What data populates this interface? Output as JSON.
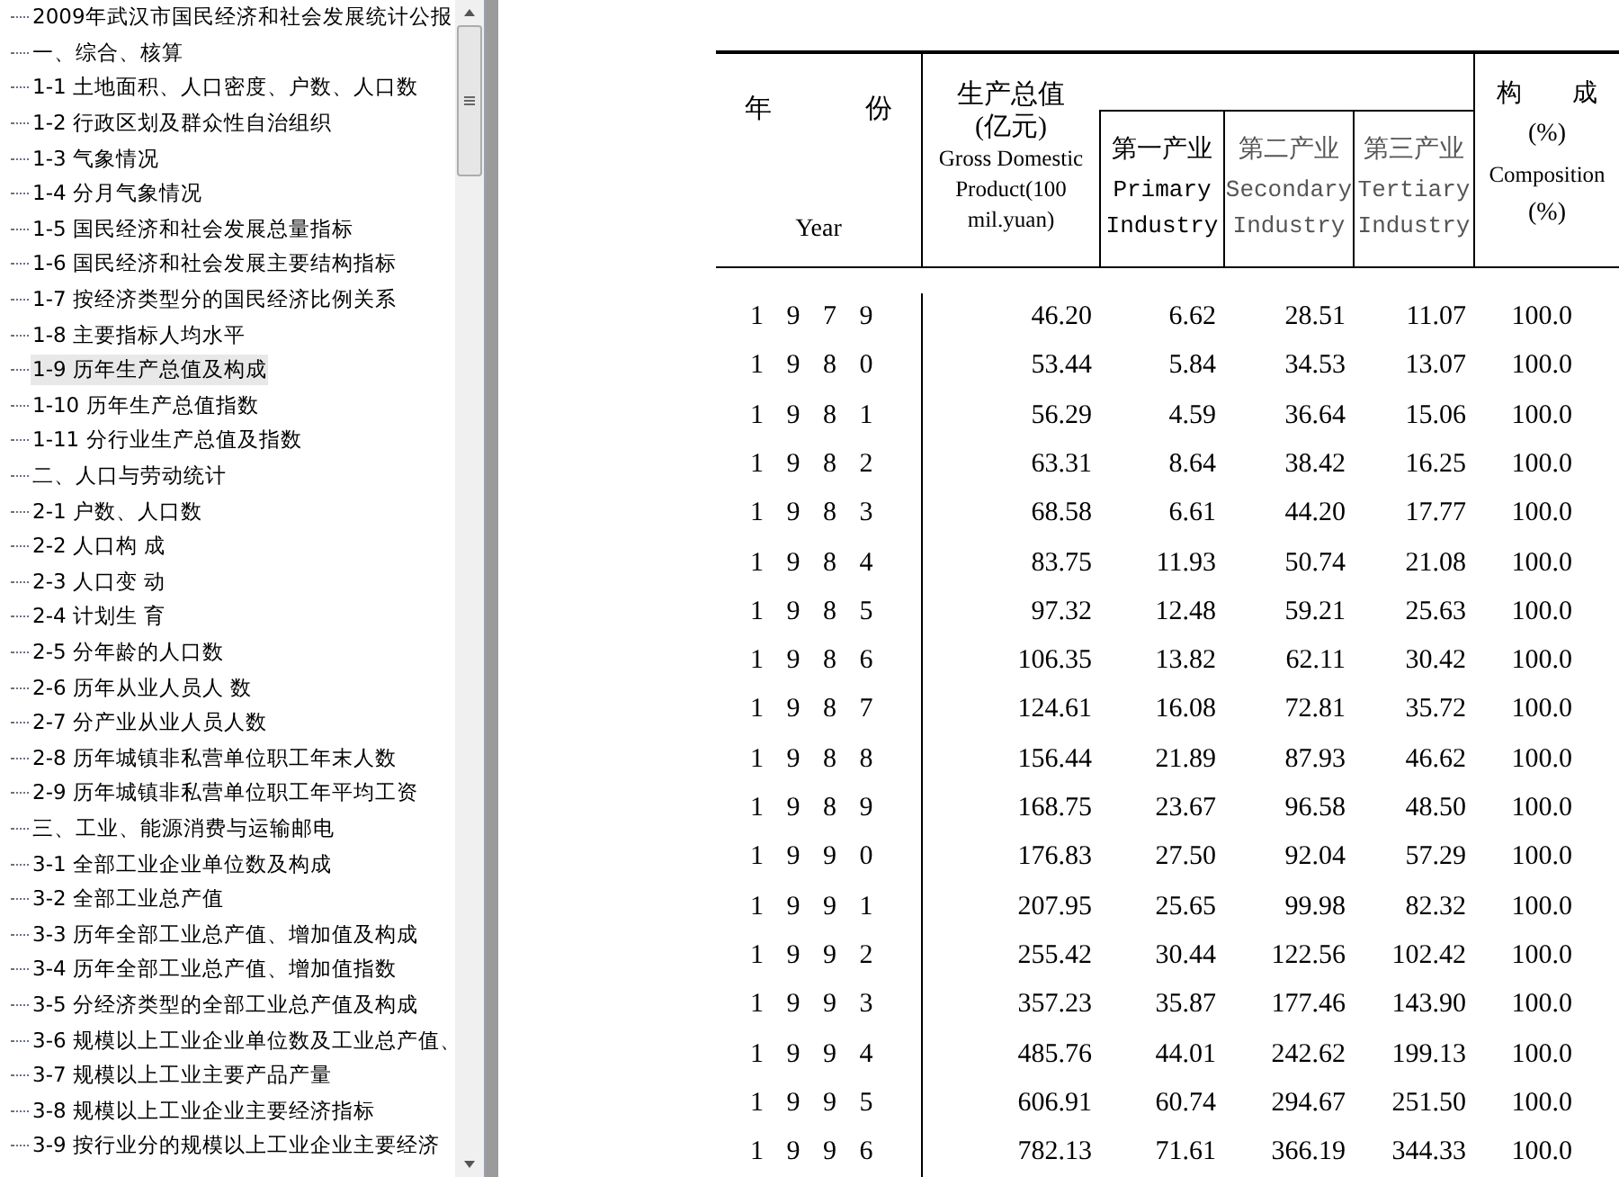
{
  "tree": {
    "items": [
      {
        "label": "2009年武汉市国民经济和社会发展统计公报",
        "selected": false
      },
      {
        "label": "一、综合、核算",
        "selected": false
      },
      {
        "label": "1-1 土地面积、人口密度、户数、人口数",
        "selected": false
      },
      {
        "label": "1-2 行政区划及群众性自治组织",
        "selected": false
      },
      {
        "label": "1-3 气象情况",
        "selected": false
      },
      {
        "label": "1-4 分月气象情况",
        "selected": false
      },
      {
        "label": "1-5 国民经济和社会发展总量指标",
        "selected": false
      },
      {
        "label": "1-6 国民经济和社会发展主要结构指标",
        "selected": false
      },
      {
        "label": "1-7 按经济类型分的国民经济比例关系",
        "selected": false
      },
      {
        "label": "1-8 主要指标人均水平",
        "selected": false
      },
      {
        "label": "1-9 历年生产总值及构成",
        "selected": true
      },
      {
        "label": "1-10 历年生产总值指数",
        "selected": false
      },
      {
        "label": "1-11 分行业生产总值及指数",
        "selected": false
      },
      {
        "label": "二、人口与劳动统计",
        "selected": false
      },
      {
        "label": "2-1 户数、人口数",
        "selected": false
      },
      {
        "label": "2-2 人口构 成",
        "selected": false
      },
      {
        "label": "2-3 人口变 动",
        "selected": false
      },
      {
        "label": "2-4 计划生 育",
        "selected": false
      },
      {
        "label": "2-5 分年龄的人口数",
        "selected": false
      },
      {
        "label": "2-6 历年从业人员人 数",
        "selected": false
      },
      {
        "label": "2-7 分产业从业人员人数",
        "selected": false
      },
      {
        "label": "2-8 历年城镇非私营单位职工年末人数",
        "selected": false
      },
      {
        "label": "2-9 历年城镇非私营单位职工年平均工资",
        "selected": false
      },
      {
        "label": "三、工业、能源消费与运输邮电",
        "selected": false
      },
      {
        "label": "3-1 全部工业企业单位数及构成",
        "selected": false
      },
      {
        "label": "3-2 全部工业总产值",
        "selected": false
      },
      {
        "label": "3-3 历年全部工业总产值、增加值及构成",
        "selected": false
      },
      {
        "label": "3-4 历年全部工业总产值、增加值指数",
        "selected": false
      },
      {
        "label": "3-5 分经济类型的全部工业总产值及构成",
        "selected": false
      },
      {
        "label": "3-6 规模以上工业企业单位数及工业总产值、",
        "selected": false
      },
      {
        "label": "3-7 规模以上工业主要产品产量",
        "selected": false
      },
      {
        "label": "3-8 规模以上工业企业主要经济指标",
        "selected": false
      },
      {
        "label": "3-9 按行业分的规模以上工业企业主要经济",
        "selected": false
      }
    ]
  },
  "table": {
    "header": {
      "year_cn": [
        "年",
        "份"
      ],
      "year_en": "Year",
      "gdp_cn": "生产总值",
      "gdp_unit": "(亿元)",
      "gdp_en": "Gross Domestic Product(100 mil.yuan)",
      "sectors": [
        {
          "cn": "第一产业",
          "en": "Primary Industry"
        },
        {
          "cn": "第二产业",
          "en": "Secondary Industry"
        },
        {
          "cn": "第三产业",
          "en": "Tertiary Industry"
        }
      ],
      "comp_cn": [
        "构",
        "成"
      ],
      "comp_pct": "(%)",
      "comp_en": "Composition",
      "comp_pct2": "(%)"
    },
    "rows": [
      [
        "1979",
        "46.20",
        "6.62",
        "28.51",
        "11.07",
        "100.0"
      ],
      [
        "1980",
        "53.44",
        "5.84",
        "34.53",
        "13.07",
        "100.0"
      ],
      [
        "1981",
        "56.29",
        "4.59",
        "36.64",
        "15.06",
        "100.0"
      ],
      [
        "1982",
        "63.31",
        "8.64",
        "38.42",
        "16.25",
        "100.0"
      ],
      [
        "1983",
        "68.58",
        "6.61",
        "44.20",
        "17.77",
        "100.0"
      ],
      [
        "1984",
        "83.75",
        "11.93",
        "50.74",
        "21.08",
        "100.0"
      ],
      [
        "1985",
        "97.32",
        "12.48",
        "59.21",
        "25.63",
        "100.0"
      ],
      [
        "1986",
        "106.35",
        "13.82",
        "62.11",
        "30.42",
        "100.0"
      ],
      [
        "1987",
        "124.61",
        "16.08",
        "72.81",
        "35.72",
        "100.0"
      ],
      [
        "1988",
        "156.44",
        "21.89",
        "87.93",
        "46.62",
        "100.0"
      ],
      [
        "1989",
        "168.75",
        "23.67",
        "96.58",
        "48.50",
        "100.0"
      ],
      [
        "1990",
        "176.83",
        "27.50",
        "92.04",
        "57.29",
        "100.0"
      ],
      [
        "1991",
        "207.95",
        "25.65",
        "99.98",
        "82.32",
        "100.0"
      ],
      [
        "1992",
        "255.42",
        "30.44",
        "122.56",
        "102.42",
        "100.0"
      ],
      [
        "1993",
        "357.23",
        "35.87",
        "177.46",
        "143.90",
        "100.0"
      ],
      [
        "1994",
        "485.76",
        "44.01",
        "242.62",
        "199.13",
        "100.0"
      ],
      [
        "1995",
        "606.91",
        "60.74",
        "294.67",
        "251.50",
        "100.0"
      ],
      [
        "1996",
        "782.13",
        "71.61",
        "366.19",
        "344.33",
        "100.0"
      ]
    ]
  }
}
